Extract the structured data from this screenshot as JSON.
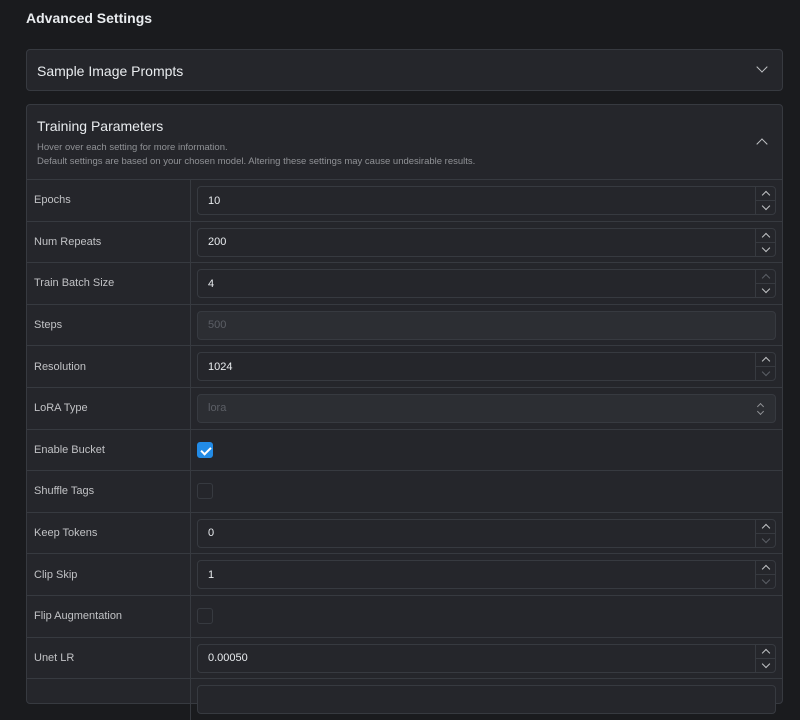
{
  "page": {
    "title": "Advanced Settings"
  },
  "sample_prompts": {
    "title": "Sample Image Prompts",
    "expanded": false
  },
  "training": {
    "title": "Training Parameters",
    "desc1": "Hover over each setting for more information.",
    "desc2": "Default settings are based on your chosen model. Altering these settings may cause undesirable results.",
    "expanded": true,
    "epochs": {
      "label": "Epochs",
      "value": "10"
    },
    "num_repeats": {
      "label": "Num Repeats",
      "value": "200"
    },
    "train_batch_size": {
      "label": "Train Batch Size",
      "value": "4"
    },
    "steps": {
      "label": "Steps",
      "value": "500"
    },
    "resolution": {
      "label": "Resolution",
      "value": "1024"
    },
    "lora_type": {
      "label": "LoRA Type",
      "value": "lora"
    },
    "enable_bucket": {
      "label": "Enable Bucket",
      "checked": true
    },
    "shuffle_tags": {
      "label": "Shuffle Tags",
      "checked": false
    },
    "keep_tokens": {
      "label": "Keep Tokens",
      "value": "0"
    },
    "clip_skip": {
      "label": "Clip Skip",
      "value": "1"
    },
    "flip_augmentation": {
      "label": "Flip Augmentation",
      "checked": false
    },
    "unet_lr": {
      "label": "Unet LR",
      "value": "0.00050"
    }
  },
  "colors": {
    "background": "#1a1b1e",
    "panel": "#25262b",
    "border": "#373a40",
    "accent": "#228be6"
  }
}
